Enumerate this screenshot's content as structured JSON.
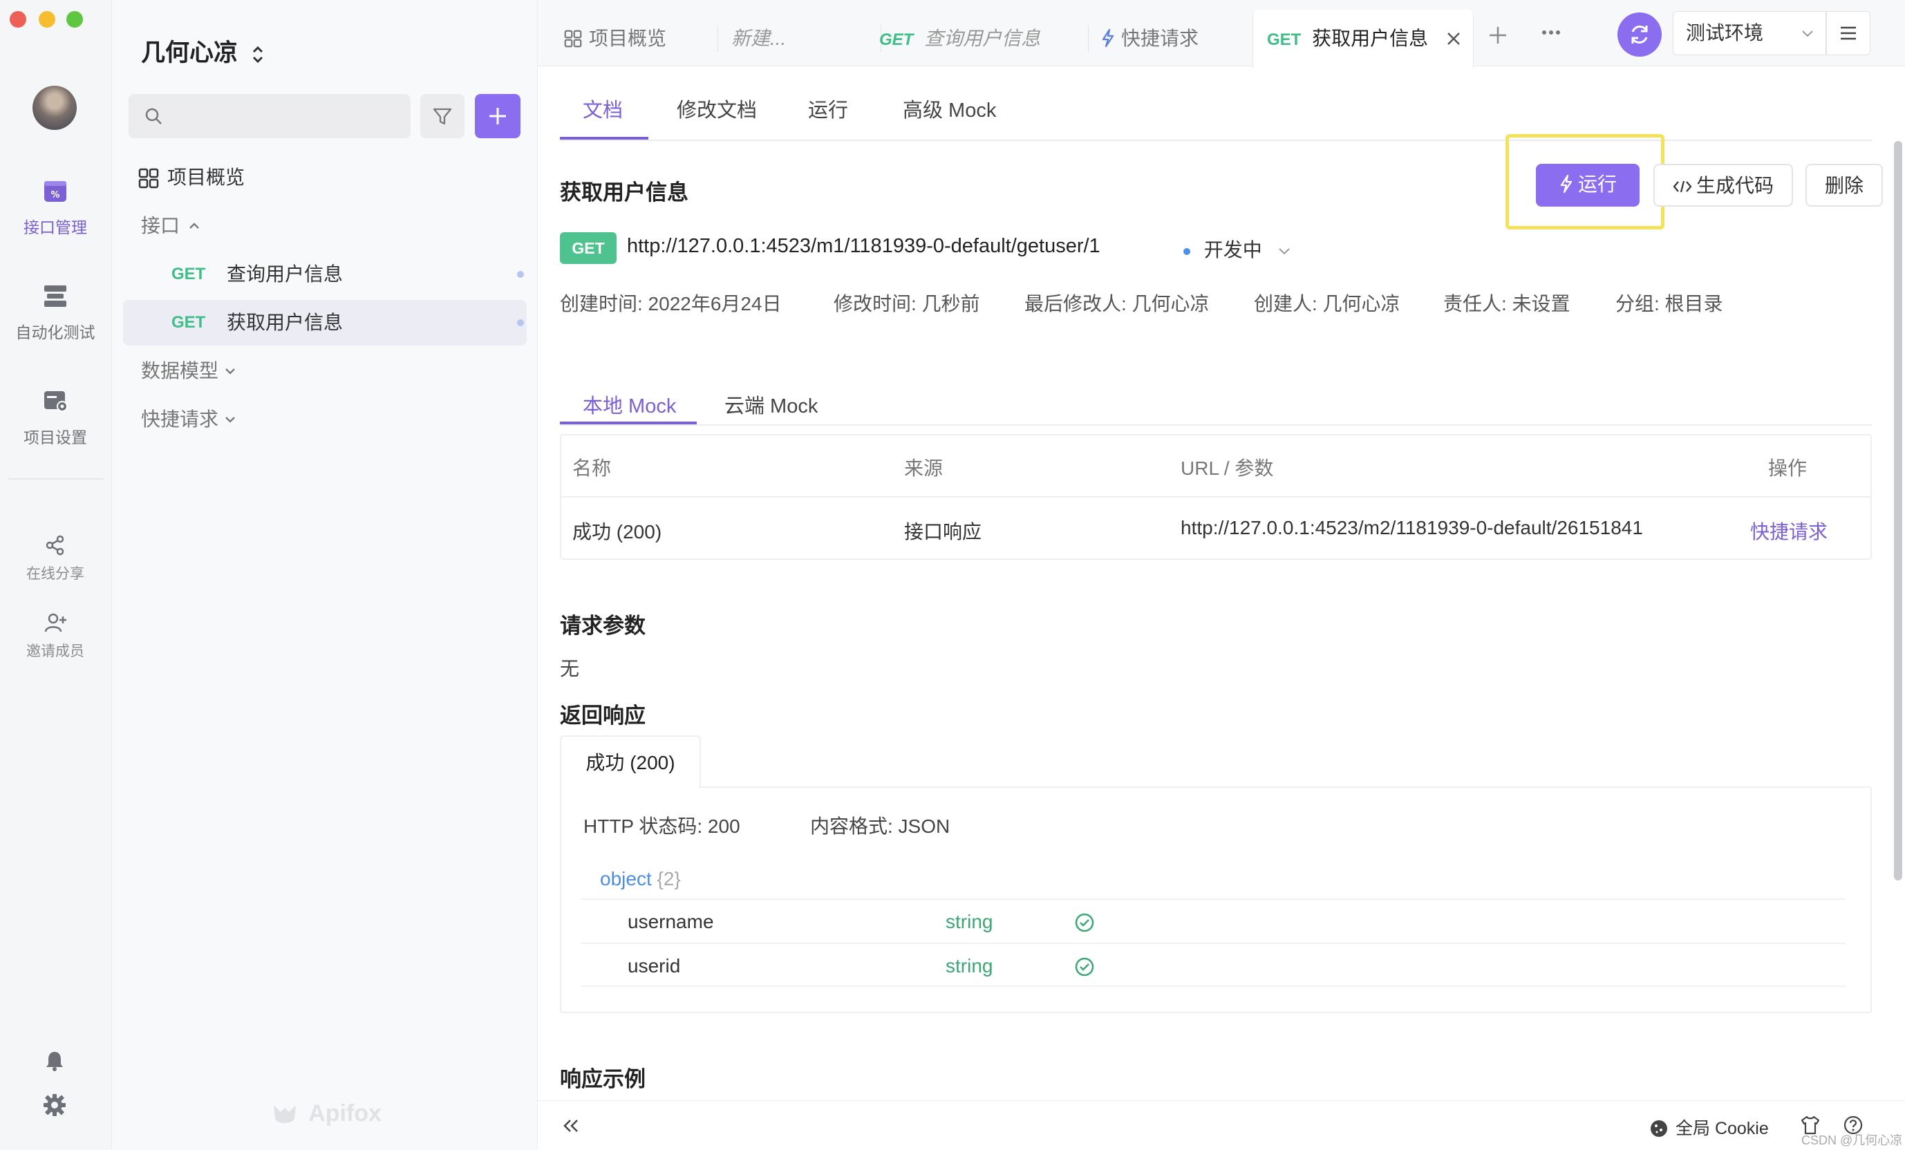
{
  "app": {
    "brand": "Apifox",
    "accent": "#8b6df0",
    "get_color": "#3fbf88"
  },
  "rail": {
    "items": [
      {
        "label": "接口管理",
        "icon": "api-management-icon",
        "active": true
      },
      {
        "label": "自动化测试",
        "icon": "automation-test-icon"
      },
      {
        "label": "项目设置",
        "icon": "project-settings-icon"
      },
      {
        "label": "在线分享",
        "icon": "share-icon"
      },
      {
        "label": "邀请成员",
        "icon": "invite-member-icon"
      }
    ]
  },
  "sidebar": {
    "project_name": "几何心凉",
    "overview": "项目概览",
    "interfaces_label": "接口",
    "interfaces": [
      {
        "method": "GET",
        "name": "查询用户信息"
      },
      {
        "method": "GET",
        "name": "获取用户信息",
        "selected": true
      }
    ],
    "data_models": "数据模型",
    "quick_requests": "快捷请求"
  },
  "tabs": {
    "items": [
      {
        "label": "项目概览"
      },
      {
        "label": "新建..."
      },
      {
        "method": "GET",
        "label": "查询用户信息"
      },
      {
        "label": "快捷请求"
      },
      {
        "method": "GET",
        "label": "获取用户信息",
        "active": true
      }
    ],
    "env": "测试环境"
  },
  "main": {
    "subtabs": [
      "文档",
      "修改文档",
      "运行",
      "高级 Mock"
    ],
    "title": "获取用户信息",
    "buttons": {
      "run": "运行",
      "gen_code": "生成代码",
      "delete": "删除"
    },
    "method": "GET",
    "url": "http://127.0.0.1:4523/m1/1181939-0-default/getuser/1",
    "status": "开发中",
    "meta": {
      "created": "创建时间: 2022年6月24日",
      "modified": "修改时间: 几秒前",
      "last_modifier": "最后修改人: 几何心凉",
      "creator": "创建人: 几何心凉",
      "owner": "责任人: 未设置",
      "group": "分组: 根目录"
    },
    "mock_tabs": [
      "本地 Mock",
      "云端 Mock"
    ],
    "mock_table": {
      "headers": [
        "名称",
        "来源",
        "URL / 参数",
        "操作"
      ],
      "rows": [
        {
          "name": "成功 (200)",
          "source": "接口响应",
          "url": "http://127.0.0.1:4523/m2/1181939-0-default/26151841",
          "action": "快捷请求"
        }
      ]
    },
    "request_params_title": "请求参数",
    "request_params_value": "无",
    "response_title": "返回响应",
    "response_tab": "成功 (200)",
    "http_status": "HTTP 状态码: 200",
    "content_type": "内容格式: JSON",
    "schema": {
      "root_type": "object",
      "root_count": "{2}",
      "fields": [
        {
          "name": "username",
          "type": "string"
        },
        {
          "name": "userid",
          "type": "string"
        }
      ]
    },
    "response_example_title": "响应示例"
  },
  "footer": {
    "cookie": "全局 Cookie"
  },
  "watermark": "CSDN @几何心凉"
}
